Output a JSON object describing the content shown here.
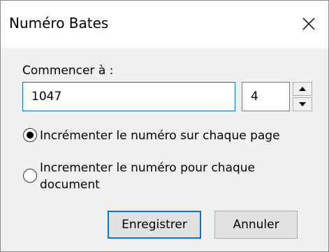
{
  "dialog": {
    "title": "Numéro Bates",
    "close_icon": "close-icon"
  },
  "form": {
    "start_label": "Commencer à :",
    "start_value": "1047",
    "digits_value": "4",
    "spin_up_icon": "arrow-up-icon",
    "spin_down_icon": "arrow-down-icon"
  },
  "options": [
    {
      "label": "Incrémenter le numéro sur chaque page",
      "selected": true
    },
    {
      "label": "Incrementer le numéro pour chaque document",
      "selected": false
    }
  ],
  "buttons": {
    "save_label": "Enregistrer",
    "cancel_label": "Annuler"
  },
  "colors": {
    "accent": "#0078d7",
    "dialog_bg": "#f0f0f0",
    "button_bg": "#e1e1e1"
  }
}
